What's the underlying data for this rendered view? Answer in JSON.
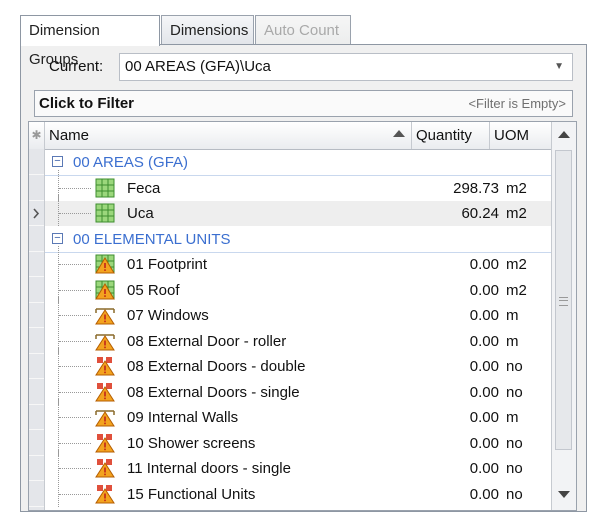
{
  "tabs": [
    {
      "label": "Dimension Groups",
      "state": "active"
    },
    {
      "label": "Dimensions",
      "state": "normal"
    },
    {
      "label": "Auto Count",
      "state": "disabled"
    }
  ],
  "current": {
    "label": "Current:",
    "value": "00 AREAS (GFA)\\Uca"
  },
  "filter": {
    "title": "Click to Filter",
    "status": "<Filter is Empty>"
  },
  "grid": {
    "columns": {
      "name": "Name",
      "quantity": "Quantity",
      "uom": "UOM"
    },
    "rows": [
      {
        "type": "group",
        "label": "00 AREAS (GFA)"
      },
      {
        "type": "item",
        "icon": "area-grid-icon",
        "name": "Feca",
        "quantity": "298.73",
        "uom": "m2"
      },
      {
        "type": "item",
        "icon": "area-grid-icon",
        "name": "Uca",
        "quantity": "60.24",
        "uom": "m2",
        "selected": true
      },
      {
        "type": "group",
        "label": "00 ELEMENTAL UNITS"
      },
      {
        "type": "item",
        "icon": "area-warning-icon",
        "name": "01 Footprint",
        "quantity": "0.00",
        "uom": "m2"
      },
      {
        "type": "item",
        "icon": "area-warning-icon",
        "name": "05 Roof",
        "quantity": "0.00",
        "uom": "m2"
      },
      {
        "type": "item",
        "icon": "linear-warning-icon",
        "name": "07 Windows",
        "quantity": "0.00",
        "uom": "m"
      },
      {
        "type": "item",
        "icon": "linear-warning-icon",
        "name": "08 External Door - roller",
        "quantity": "0.00",
        "uom": "m"
      },
      {
        "type": "item",
        "icon": "count-warning-icon",
        "name": "08 External Doors - double",
        "quantity": "0.00",
        "uom": "no"
      },
      {
        "type": "item",
        "icon": "count-warning-icon",
        "name": "08 External Doors - single",
        "quantity": "0.00",
        "uom": "no"
      },
      {
        "type": "item",
        "icon": "linear-warning-icon",
        "name": "09 Internal Walls",
        "quantity": "0.00",
        "uom": "m"
      },
      {
        "type": "item",
        "icon": "count-warning-icon",
        "name": "10 Shower screens",
        "quantity": "0.00",
        "uom": "no"
      },
      {
        "type": "item",
        "icon": "count-warning-icon",
        "name": "11 Internal doors - single",
        "quantity": "0.00",
        "uom": "no"
      },
      {
        "type": "item",
        "icon": "count-warning-icon",
        "name": "15 Functional Units",
        "quantity": "0.00",
        "uom": "no"
      }
    ]
  },
  "colors": {
    "group_text": "#3b6fd0",
    "selected_row": "#eeeeee",
    "warning": "#f0a020",
    "grid_icon": "#4caf50"
  }
}
